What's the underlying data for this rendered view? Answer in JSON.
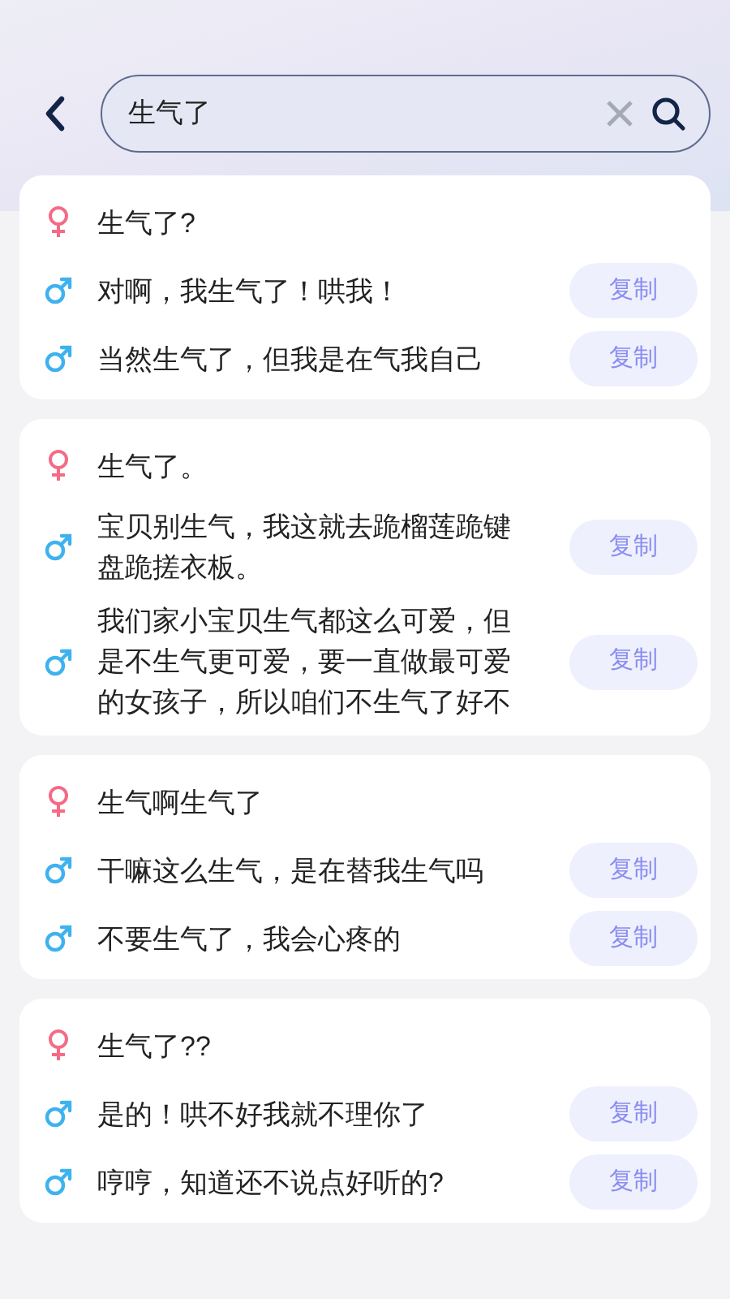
{
  "search": {
    "value": "生气了"
  },
  "cards": [
    {
      "messages": [
        {
          "kind": "female",
          "text": "生气了?"
        },
        {
          "kind": "male",
          "text": "对啊，我生气了！哄我！",
          "action": "复制"
        },
        {
          "kind": "male",
          "text": "当然生气了，但我是在气我自己",
          "action": "复制"
        }
      ]
    },
    {
      "messages": [
        {
          "kind": "female",
          "text": "生气了。"
        },
        {
          "kind": "male",
          "text": "宝贝别生气，我这就去跪榴莲跪键盘跪搓衣板。",
          "action": "复制"
        },
        {
          "kind": "male",
          "text": "我们家小宝贝生气都这么可爱，但是不生气更可爱，要一直做最可爱的女孩子，所以咱们不生气了好不",
          "action": "复制"
        }
      ]
    },
    {
      "messages": [
        {
          "kind": "female",
          "text": "生气啊生气了"
        },
        {
          "kind": "male",
          "text": "干嘛这么生气，是在替我生气吗",
          "action": "复制"
        },
        {
          "kind": "male",
          "text": "不要生气了，我会心疼的",
          "action": "复制"
        }
      ]
    },
    {
      "messages": [
        {
          "kind": "female",
          "text": "生气了??"
        },
        {
          "kind": "male",
          "text": "是的！哄不好我就不理你了",
          "action": "复制"
        },
        {
          "kind": "male",
          "text": "哼哼，知道还不说点好听的?",
          "action": "复制"
        }
      ]
    }
  ]
}
